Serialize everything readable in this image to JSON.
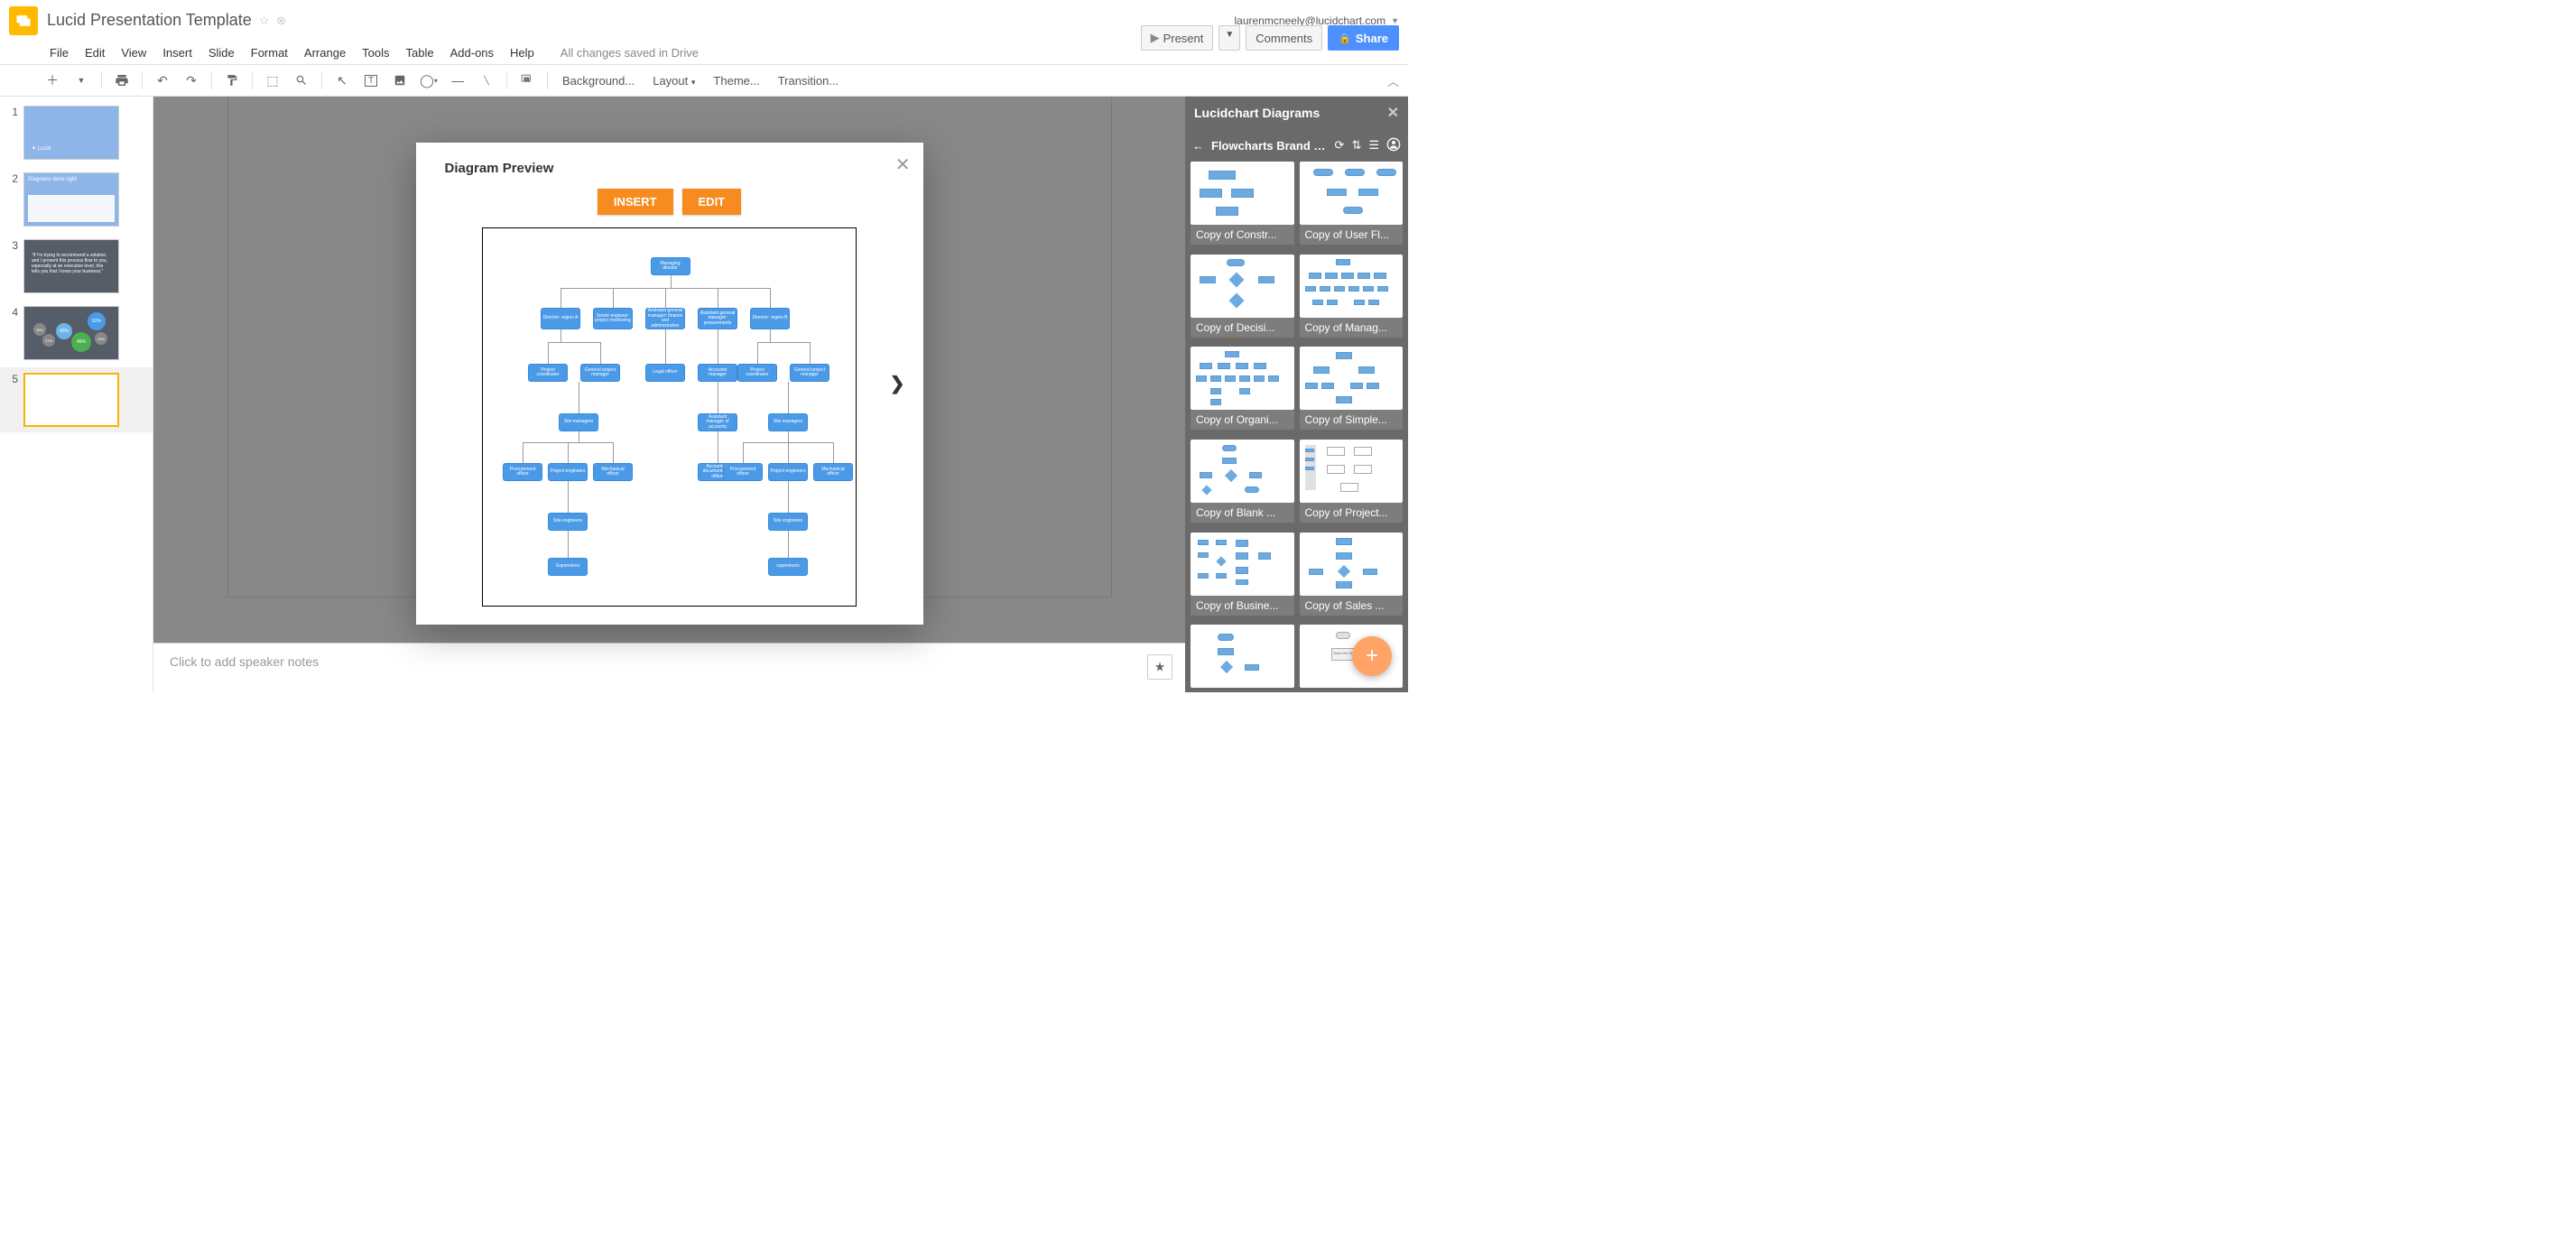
{
  "header": {
    "doc_title": "Lucid Presentation Template",
    "user_email": "laurenmcneely@lucidchart.com"
  },
  "menubar": [
    "File",
    "Edit",
    "View",
    "Insert",
    "Slide",
    "Format",
    "Arrange",
    "Tools",
    "Table",
    "Add-ons",
    "Help"
  ],
  "save_status": "All changes saved in Drive",
  "top_buttons": {
    "present": "Present",
    "comments": "Comments",
    "share": "Share"
  },
  "toolbar_text": {
    "background": "Background...",
    "layout": "Layout",
    "theme": "Theme...",
    "transition": "Transition..."
  },
  "slides": [
    {
      "num": "1"
    },
    {
      "num": "2"
    },
    {
      "num": "3"
    },
    {
      "num": "4"
    },
    {
      "num": "5"
    }
  ],
  "speaker_notes_placeholder": "Click to add speaker notes",
  "modal": {
    "title": "Diagram Preview",
    "insert": "INSERT",
    "edit": "EDIT"
  },
  "org_chart": {
    "root": "Managing director",
    "row2": [
      "Director: region A",
      "Senior engineer: project monitoring",
      "Assistant general manager: finance and administration",
      "Assistant general manager: procurements",
      "Director: region B"
    ],
    "row3": [
      "Project coordinator",
      "General project manager",
      "Legal officer",
      "Accounts manager",
      "Project coordinator",
      "General project manager"
    ],
    "row4": [
      "Site managers",
      "Assistant manager of accounts",
      "Site managers"
    ],
    "row5": [
      "Procurement officer",
      "Project engineers",
      "Mechanical officer",
      "Accounts & documentation officer",
      "Procurement officer",
      "Project engineers",
      "Mechanical officer"
    ],
    "row6": [
      "Site engineers",
      "Site engineers"
    ],
    "row7": [
      "Supervisors",
      "supervisors"
    ]
  },
  "right_panel": {
    "title": "Lucidchart Diagrams",
    "nav_title": "Flowcharts Brand S...",
    "items": [
      "Copy of Constr...",
      "Copy of User Fl...",
      "Copy of Decisi...",
      "Copy of Manag...",
      "Copy of Organi...",
      "Copy of Simple...",
      "Copy of Blank ...",
      "Copy of Project...",
      "Copy of Busine...",
      "Copy of Sales ..."
    ]
  }
}
